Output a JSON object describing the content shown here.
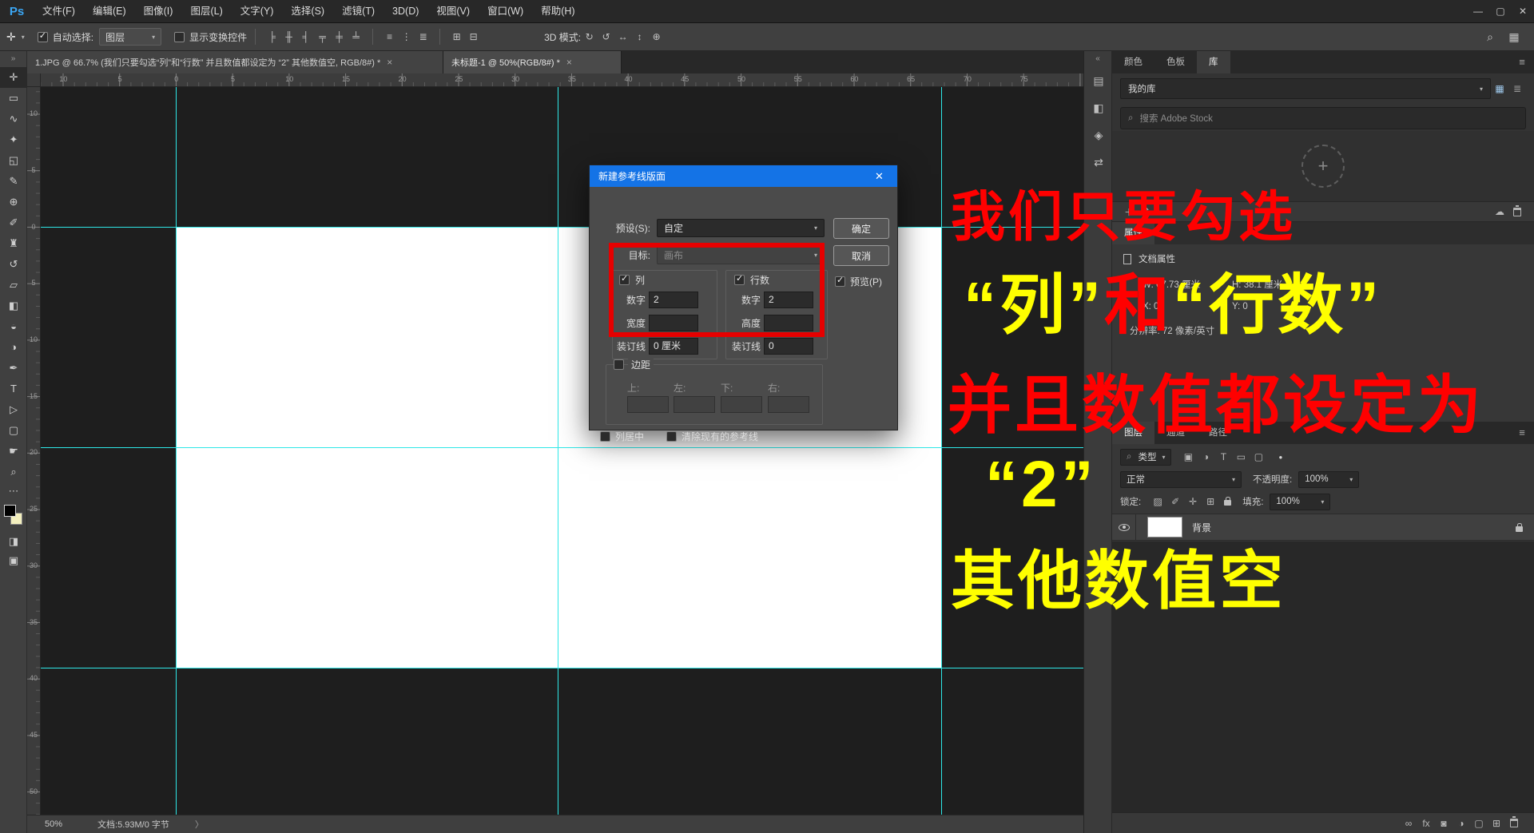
{
  "window": {
    "logo": "Ps",
    "controls": {
      "minimize": "—",
      "maximize": "▢",
      "close": "✕"
    }
  },
  "menubar": {
    "items": [
      "文件(F)",
      "编辑(E)",
      "图像(I)",
      "图层(L)",
      "文字(Y)",
      "选择(S)",
      "滤镜(T)",
      "3D(D)",
      "视图(V)",
      "窗口(W)",
      "帮助(H)"
    ]
  },
  "options_bar": {
    "tool_icon": "✛",
    "auto_select": {
      "checked": true,
      "label": "自动选择:",
      "value": "图层"
    },
    "show_transform": {
      "checked": false,
      "label": "显示变换控件"
    },
    "align_icons": [
      {
        "name": "align-left-icon",
        "glyph": "╞"
      },
      {
        "name": "align-center-h-icon",
        "glyph": "╫"
      },
      {
        "name": "align-right-icon",
        "glyph": "╡"
      },
      {
        "name": "align-top-icon",
        "glyph": "╤"
      },
      {
        "name": "align-middle-icon",
        "glyph": "╪"
      },
      {
        "name": "align-bottom-icon",
        "glyph": "╧"
      }
    ],
    "distribute_icons": [
      {
        "name": "distribute-vertical-icon",
        "glyph": "≡"
      },
      {
        "name": "distribute-horizontal-icon",
        "glyph": "⋮"
      },
      {
        "name": "distribute-spacing-icon",
        "glyph": "≣"
      }
    ],
    "extra_icons": [
      {
        "name": "auto-align-icon",
        "glyph": "⊞"
      },
      {
        "name": "auto-blend-icon",
        "glyph": "⊟"
      }
    ],
    "mode_label": "3D 模式:",
    "mode_icons": [
      {
        "name": "3d-rotate-icon",
        "glyph": "↻"
      },
      {
        "name": "3d-roll-icon",
        "glyph": "↺"
      },
      {
        "name": "3d-drag-icon",
        "glyph": "↔"
      },
      {
        "name": "3d-slide-icon",
        "glyph": "↕"
      },
      {
        "name": "3d-scale-icon",
        "glyph": "⊕"
      }
    ],
    "search_icon": "⌕",
    "layout_icon": "▦"
  },
  "tabs": [
    {
      "label": "1.JPG @ 66.7% (我们只要勾选“列”和“行数” 并且数值都设定为 “2” 其他数值空, RGB/8#) *",
      "close": "×"
    },
    {
      "label": "未标题-1 @ 50%(RGB/8#) *",
      "close": "×"
    }
  ],
  "toolbar": {
    "collapse": "»",
    "tools": [
      {
        "name": "tool-move",
        "glyph": "✛",
        "cls": "active"
      },
      {
        "name": "tool-marquee",
        "glyph": "▭"
      },
      {
        "name": "tool-lasso",
        "glyph": "∿"
      },
      {
        "name": "tool-quick-select",
        "glyph": "✦"
      },
      {
        "name": "tool-crop",
        "glyph": "◱"
      },
      {
        "name": "tool-eyedropper",
        "glyph": "✎"
      },
      {
        "name": "tool-healing-brush",
        "glyph": "⊕"
      },
      {
        "name": "tool-brush",
        "glyph": "✐"
      },
      {
        "name": "tool-clone-stamp",
        "glyph": "♜"
      },
      {
        "name": "tool-history-brush",
        "glyph": "↺"
      },
      {
        "name": "tool-eraser",
        "glyph": "▱"
      },
      {
        "name": "tool-gradient",
        "glyph": "◧"
      },
      {
        "name": "tool-blur",
        "glyph": "◒"
      },
      {
        "name": "tool-dodge",
        "glyph": "◑"
      },
      {
        "name": "tool-pen",
        "glyph": "✒"
      },
      {
        "name": "tool-type",
        "glyph": "T"
      },
      {
        "name": "tool-path-select",
        "glyph": "▷"
      },
      {
        "name": "tool-shape",
        "glyph": "▢"
      },
      {
        "name": "tool-hand",
        "glyph": "☛"
      },
      {
        "name": "tool-zoom",
        "glyph": "⌕"
      }
    ],
    "ellipsis": "⋯",
    "quick_mask_icon": "◨",
    "screen_mode_icon": "▣"
  },
  "rulers": {
    "h_labels": [
      "10",
      "5",
      "0",
      "5",
      "10",
      "15",
      "20",
      "25",
      "30",
      "35",
      "40",
      "45",
      "50",
      "55",
      "60",
      "65",
      "70",
      "75"
    ],
    "v_labels": [
      "10",
      "5",
      "0",
      "5",
      "10",
      "15",
      "20",
      "25",
      "30",
      "35",
      "40",
      "45",
      "50"
    ]
  },
  "dialog": {
    "title": "新建参考线版面",
    "close_icon": "✕",
    "preset_label": "预设(S):",
    "preset_value": "自定",
    "target_label": "目标:",
    "target_value": "画布",
    "ok_label": "确定",
    "cancel_label": "取消",
    "columns": {
      "checked": true,
      "label": "列",
      "number_label": "数字",
      "number_value": "2",
      "width_label": "宽度",
      "width_value": "",
      "gutter_label": "装订线",
      "gutter_value": "0 厘米"
    },
    "rows": {
      "checked": true,
      "label": "行数",
      "number_label": "数字",
      "number_value": "2",
      "height_label": "高度",
      "height_value": "",
      "gutter_label": "装订线",
      "gutter_value": "0"
    },
    "preview": {
      "checked": true,
      "label": "预览(P)"
    },
    "margins": {
      "checked": false,
      "label": "边距",
      "top_label": "上:",
      "left_label": "左:",
      "bottom_label": "下:",
      "right_label": "右:",
      "top_value": "",
      "left_value": "",
      "bottom_value": "",
      "right_value": ""
    },
    "center_columns": {
      "checked": false,
      "label": "列居中"
    },
    "clear_guides": {
      "checked": false,
      "label": "清除现有的参考线"
    }
  },
  "status_bar": {
    "zoom": "50%",
    "doc_info": "文档:5.93M/0 字节",
    "chevron": "〉"
  },
  "panels": {
    "strip_collapse": "«",
    "strip_icons": [
      {
        "name": "histogram-panel-icon",
        "glyph": "▤"
      },
      {
        "name": "navigator-panel-icon",
        "glyph": "◧"
      },
      {
        "name": "info-panel-icon",
        "glyph": "◈"
      },
      {
        "name": "clone-source-panel-icon",
        "glyph": "⇄"
      }
    ],
    "tab_bar": {
      "tabs": [
        "颜色",
        "色板",
        "库"
      ],
      "active": "库",
      "menu_icon": "≡"
    },
    "library": {
      "dropdown_value": "我的库",
      "grid_view_icon": "▦",
      "list_view_icon": "≣",
      "search_icon": "⌕",
      "search_placeholder": "搜索 Adobe Stock",
      "drop_plus": "+",
      "add_icon": "＋",
      "share_icon": "↥",
      "sync_icon": "☁"
    },
    "properties": {
      "title": "属性",
      "doc_label": "文档属性",
      "w": "W: 67.73 厘米",
      "h": "H: 38.1 厘米",
      "x": "X: 0",
      "y": "Y: 0",
      "resolution": "分辨率: 72 像素/英寸"
    },
    "layers": {
      "tabs": [
        "图层",
        "通道",
        "路径"
      ],
      "menu_icon": "≡",
      "filter_label": "类型",
      "filter_icons": [
        {
          "name": "filter-pixel-layers-icon",
          "glyph": "▣"
        },
        {
          "name": "filter-adjustment-layers-icon",
          "glyph": "◑"
        },
        {
          "name": "filter-type-layers-icon",
          "glyph": "T"
        },
        {
          "name": "filter-shape-layers-icon",
          "glyph": "▭"
        },
        {
          "name": "filter-smart-objects-icon",
          "glyph": "▢"
        }
      ],
      "filter_toggle_icon": "●",
      "blend_mode": "正常",
      "opacity_label": "不透明度:",
      "opacity_value": "100%",
      "lock_label": "锁定:",
      "lock_icons": [
        {
          "name": "lock-transparency-icon",
          "glyph": "▨"
        },
        {
          "name": "lock-pixels-icon",
          "glyph": "✐"
        },
        {
          "name": "lock-position-icon",
          "glyph": "✛"
        },
        {
          "name": "lock-artboard-icon",
          "glyph": "⊞"
        }
      ],
      "fill_label": "填充:",
      "fill_value": "100%",
      "layer_name": "背景",
      "footer_icons": [
        {
          "name": "link-layers-icon",
          "glyph": "∞"
        },
        {
          "name": "layer-style-icon",
          "glyph": "fx"
        },
        {
          "name": "layer-mask-icon",
          "glyph": "◙"
        },
        {
          "name": "adjustment-layer-icon",
          "glyph": "◑"
        },
        {
          "name": "layer-group-icon",
          "glyph": "▢"
        },
        {
          "name": "new-layer-icon",
          "glyph": "⊞"
        }
      ]
    }
  },
  "annotation": {
    "line1": "我们只要勾选",
    "line2": [
      {
        "t": "“列”",
        "cls": "yellow"
      },
      {
        "t": "和",
        "cls": "red"
      },
      {
        "t": "“行数”",
        "cls": "yellow"
      }
    ],
    "line3": "并且数值都设定为",
    "line4": "“2”",
    "line5": "其他数值空"
  },
  "colors": {
    "dialog_titlebar_blue": "#1473e6",
    "guide_cyan": "#2ee8e8",
    "annotation_red": "#ff0000",
    "annotation_yellow": "#ffff00",
    "highlight_box_red": "#e60000",
    "foreground_swatch": "#000000",
    "background_swatch": "#f3efbe"
  }
}
